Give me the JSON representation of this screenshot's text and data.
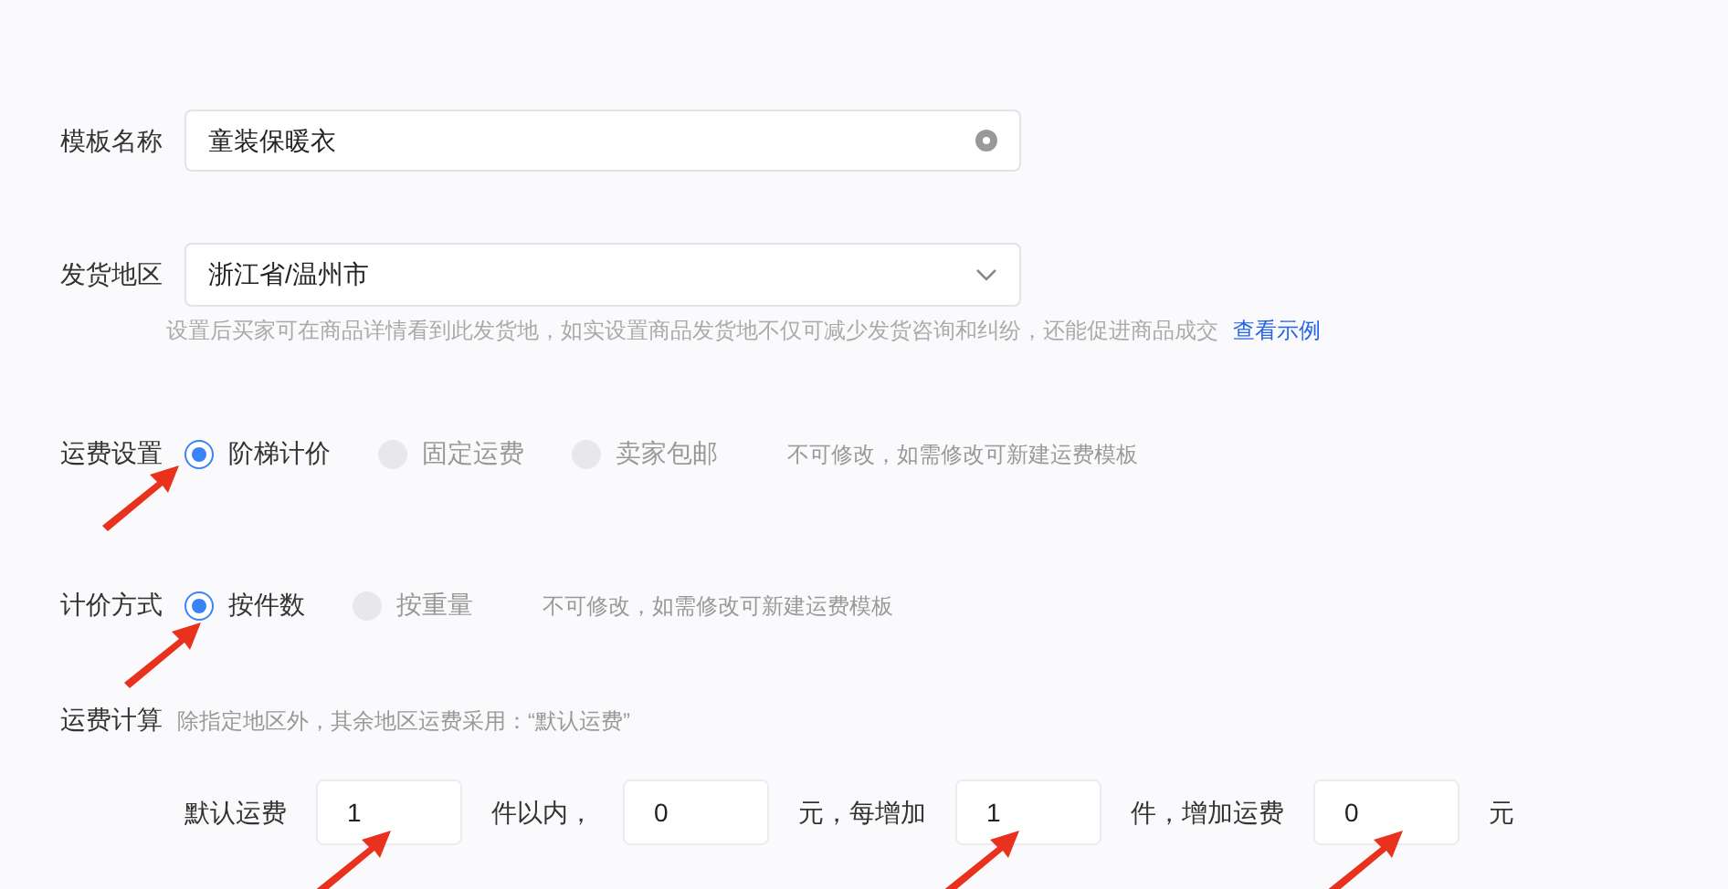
{
  "template_name": {
    "label": "模板名称",
    "value": "童装保暖衣"
  },
  "ship_region": {
    "label": "发货地区",
    "value": "浙江省/温州市",
    "hint": "设置后买家可在商品详情看到此发货地，如实设置商品发货地不仅可减少发货咨询和纠纷，还能促进商品成交",
    "link": "查看示例"
  },
  "fee_setting": {
    "label": "运费设置",
    "options": [
      {
        "label": "阶梯计价",
        "selected": true
      },
      {
        "label": "固定运费",
        "selected": false
      },
      {
        "label": "卖家包邮",
        "selected": false
      }
    ],
    "note": "不可修改，如需修改可新建运费模板"
  },
  "pricing_method": {
    "label": "计价方式",
    "options": [
      {
        "label": "按件数",
        "selected": true
      },
      {
        "label": "按重量",
        "selected": false
      }
    ],
    "note": "不可修改，如需修改可新建运费模板"
  },
  "fee_calc": {
    "label": "运费计算",
    "note": "除指定地区外，其余地区运费采用：“默认运费”",
    "items": [
      {
        "kind": "text",
        "text": "默认运费"
      },
      {
        "kind": "input",
        "value": "1"
      },
      {
        "kind": "text",
        "text": "件以内，"
      },
      {
        "kind": "input",
        "value": "0"
      },
      {
        "kind": "text",
        "text": "元，每增加"
      },
      {
        "kind": "input",
        "value": "1"
      },
      {
        "kind": "text",
        "text": "件，增加运费"
      },
      {
        "kind": "input",
        "value": "0"
      },
      {
        "kind": "text",
        "text": "元"
      }
    ]
  }
}
